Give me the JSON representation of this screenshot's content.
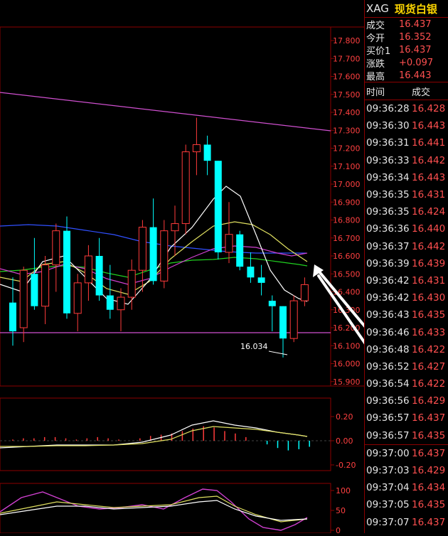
{
  "instrument": {
    "code": "XAG",
    "name": "现货白银"
  },
  "quote": [
    {
      "label": "成交",
      "value": "16.437"
    },
    {
      "label": "今开",
      "value": "16.352"
    },
    {
      "label": "买价1",
      "value": "16.437"
    },
    {
      "label": "涨跌",
      "value": "+0.097"
    },
    {
      "label": "最高",
      "value": "16.443"
    }
  ],
  "ticks_header": {
    "time": "时间",
    "price": "成交"
  },
  "ticks_group1": [
    {
      "time": "09:36:28",
      "price": "16.428"
    },
    {
      "time": "09:36:30",
      "price": "16.443"
    },
    {
      "time": "09:36:31",
      "price": "16.441"
    },
    {
      "time": "09:36:33",
      "price": "16.442"
    },
    {
      "time": "09:36:34",
      "price": "16.443"
    },
    {
      "time": "09:36:35",
      "price": "16.431"
    },
    {
      "time": "09:36:35",
      "price": "16.424"
    },
    {
      "time": "09:36:36",
      "price": "16.440"
    },
    {
      "time": "09:36:37",
      "price": "16.442"
    },
    {
      "time": "09:36:39",
      "price": "16.439"
    },
    {
      "time": "09:36:42",
      "price": "16.431"
    },
    {
      "time": "09:36:42",
      "price": "16.430"
    },
    {
      "time": "09:36:43",
      "price": "16.435"
    },
    {
      "time": "09:36:46",
      "price": "16.433"
    },
    {
      "time": "09:36:48",
      "price": "16.422"
    },
    {
      "time": "09:36:52",
      "price": "16.427"
    },
    {
      "time": "09:36:54",
      "price": "16.422"
    },
    {
      "time": "09:36:56",
      "price": "16.429"
    },
    {
      "time": "09:36:57",
      "price": "16.437"
    },
    {
      "time": "09:36:57",
      "price": "16.435"
    }
  ],
  "ticks_group2": [
    {
      "time": "09:37:00",
      "price": "16.437"
    },
    {
      "time": "09:37:03",
      "price": "16.429"
    },
    {
      "time": "09:37:04",
      "price": "16.434"
    },
    {
      "time": "09:37:05",
      "price": "16.435"
    },
    {
      "time": "09:37:07",
      "price": "16.437"
    }
  ],
  "price_axis": [
    "17.800",
    "17.700",
    "17.600",
    "17.500",
    "17.400",
    "17.300",
    "17.200",
    "17.100",
    "17.000",
    "16.900",
    "16.800",
    "16.700",
    "16.600",
    "16.500",
    "16.400",
    "16.300",
    "16.200",
    "16.100",
    "16.000",
    "15.900"
  ],
  "macd_axis": [
    "0.20",
    "0.00",
    "-0.20"
  ],
  "kdj_axis": [
    "100",
    "50",
    "0"
  ],
  "low_annotation": "16.034",
  "colors": {
    "up": "#ff3b3b",
    "down": "#00ffff",
    "panel_border": "#8b0000",
    "price_text": "#ff5050",
    "header_name": "#ffd700"
  },
  "chart_data": {
    "type": "candlestick",
    "price_range": [
      15.9,
      17.8
    ],
    "candles": [
      {
        "o": 16.34,
        "h": 16.48,
        "l": 16.1,
        "c": 16.18
      },
      {
        "o": 16.2,
        "h": 16.54,
        "l": 16.12,
        "c": 16.52
      },
      {
        "o": 16.5,
        "h": 16.7,
        "l": 16.3,
        "c": 16.32
      },
      {
        "o": 16.32,
        "h": 16.6,
        "l": 16.22,
        "c": 16.55
      },
      {
        "o": 16.55,
        "h": 16.78,
        "l": 16.4,
        "c": 16.74
      },
      {
        "o": 16.74,
        "h": 16.82,
        "l": 16.25,
        "c": 16.28
      },
      {
        "o": 16.28,
        "h": 16.5,
        "l": 16.18,
        "c": 16.45
      },
      {
        "o": 16.45,
        "h": 16.66,
        "l": 16.35,
        "c": 16.6
      },
      {
        "o": 16.6,
        "h": 16.7,
        "l": 16.35,
        "c": 16.38
      },
      {
        "o": 16.38,
        "h": 16.55,
        "l": 16.25,
        "c": 16.3
      },
      {
        "o": 16.3,
        "h": 16.42,
        "l": 16.18,
        "c": 16.37
      },
      {
        "o": 16.37,
        "h": 16.58,
        "l": 16.3,
        "c": 16.52
      },
      {
        "o": 16.52,
        "h": 16.8,
        "l": 16.4,
        "c": 16.76
      },
      {
        "o": 16.76,
        "h": 16.92,
        "l": 16.44,
        "c": 16.46
      },
      {
        "o": 16.46,
        "h": 16.8,
        "l": 16.42,
        "c": 16.74
      },
      {
        "o": 16.74,
        "h": 16.88,
        "l": 16.6,
        "c": 16.78
      },
      {
        "o": 16.78,
        "h": 17.22,
        "l": 16.72,
        "c": 17.18
      },
      {
        "o": 17.18,
        "h": 17.37,
        "l": 17.05,
        "c": 17.22
      },
      {
        "o": 17.22,
        "h": 17.27,
        "l": 17.05,
        "c": 17.13
      },
      {
        "o": 17.13,
        "h": 17.13,
        "l": 16.58,
        "c": 16.62
      },
      {
        "o": 16.62,
        "h": 16.9,
        "l": 16.56,
        "c": 16.72
      },
      {
        "o": 16.72,
        "h": 16.74,
        "l": 16.52,
        "c": 16.54
      },
      {
        "o": 16.54,
        "h": 16.62,
        "l": 16.45,
        "c": 16.48
      },
      {
        "o": 16.48,
        "h": 16.55,
        "l": 16.38,
        "c": 16.45
      },
      {
        "o": 16.35,
        "h": 16.38,
        "l": 16.18,
        "c": 16.32
      },
      {
        "o": 16.32,
        "h": 16.32,
        "l": 16.034,
        "c": 16.14
      },
      {
        "o": 16.14,
        "h": 16.38,
        "l": 16.12,
        "c": 16.35
      },
      {
        "o": 16.35,
        "h": 16.48,
        "l": 16.32,
        "c": 16.44
      }
    ]
  }
}
